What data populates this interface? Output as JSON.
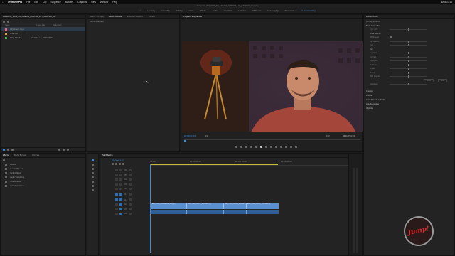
{
  "menubar": {
    "app": "Premiere Pro",
    "items": [
      "File",
      "Edit",
      "Clip",
      "Sequence",
      "Markers",
      "Graphics",
      "View",
      "Window",
      "Help"
    ],
    "clock": "Wed 10:16"
  },
  "titlebar": {
    "path": "/Volumes/.../NO_HOW_TO_CREATE_CUSTOM_LUT_GRAPHIC_01.prproj"
  },
  "workspaces": {
    "items": [
      "Learning",
      "Assembly",
      "Editing",
      "Color",
      "Effects",
      "Audio",
      "Graphics",
      "Libraries",
      "All Panels",
      "Metalogging",
      "Production",
      "2 Lumetri setting"
    ],
    "active_index": 11
  },
  "project_panel": {
    "tab": "Project: 02_HOW_TO_CREATE_CUSTOM_LUT_GRAPHIC_01",
    "columns": {
      "name": "Name",
      "frame_rate": "Frame Rate",
      "media_start": "Media Start"
    },
    "items": [
      {
        "name": "Adjustment Layer",
        "color": "#e46b88",
        "fps": "",
        "start": ""
      },
      {
        "name": "Final Color",
        "color": "#e7a12e",
        "fps": "",
        "start": ""
      },
      {
        "name": "SEQUENCE",
        "color": "#3fae5a",
        "fps": "23.976 fps",
        "start": "00:00:00:00"
      }
    ]
  },
  "effects_panel": {
    "tabs": [
      "Effects",
      "Media Browser",
      "Libraries"
    ],
    "items": [
      "Presets",
      "Lumetri Presets",
      "Audio Effects",
      "Audio Transitions",
      "Video Effects",
      "Video Transitions"
    ]
  },
  "source_panel": {
    "tabs": [
      "Source: (no clips)",
      "Effect Controls",
      "Essential Graphics",
      "Lumetri",
      "Info"
    ],
    "subtitle": "(no clip selected)"
  },
  "program_monitor": {
    "title": "Program: SEQUENCE",
    "timecode_in": "00:00:01:03",
    "zoom": "Fit",
    "quality": "Full",
    "timecode_out": "00:10:54:13"
  },
  "timeline": {
    "tab": "SEQUENCE",
    "timecode": "00:00:01:03",
    "ruler": [
      "00:00",
      "00:00:05:00",
      "00:00:10:00",
      "00:00:15:00"
    ],
    "video_tracks": [
      "V6",
      "V5",
      "V4",
      "V3",
      "V2",
      "V1"
    ],
    "audio_tracks": [
      "A1",
      "A2",
      "A3",
      "A4"
    ],
    "clips": [
      "A001_C005_0502HA_S000.MP4 [V]",
      "A001_C006_0502GL_S001.MP4 [V]",
      "A001_C007_0502PA_S000.MP4 [V]",
      "A001_C008_0502PF_S000.MP4 [V]"
    ]
  },
  "lumetri": {
    "title": "Lumetri Color",
    "target": "(no clip selected)",
    "sections": [
      "Basic Correction",
      "Creative",
      "Curves",
      "Color Wheels & Match",
      "HSL Secondary",
      "Vignette"
    ],
    "basic": {
      "input_lut": "Input LUT",
      "white_balance": "White Balance",
      "wb_selector": "WB Selector",
      "temperature": "Temperature",
      "tint": "Tint",
      "tone": "Tone",
      "tone_rows": [
        "Exposure",
        "Contrast",
        "Highlights",
        "Shadows",
        "Whites",
        "Blacks"
      ],
      "hdr": "HDR Specular",
      "reset": "Reset",
      "auto": "Auto",
      "saturation": "Saturation"
    }
  },
  "watermark": "Jump!"
}
